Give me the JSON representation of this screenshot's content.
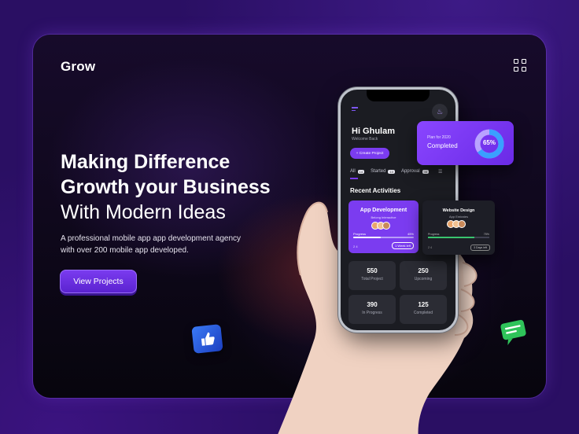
{
  "brand": {
    "logo": "Grow"
  },
  "hero": {
    "title_line1": "Making Difference",
    "title_line2": "Growth your Business",
    "title_line3": "With Modern Ideas",
    "description": "A professional mobile app app development agency with over 200 mobile app developed.",
    "cta_label": "View Projects"
  },
  "phone": {
    "greeting": "Hi Ghulam",
    "welcome": "Welcome Back",
    "create_button": "+ Create Project",
    "tabs": [
      {
        "label": "All",
        "count": "14"
      },
      {
        "label": "Started",
        "count": "10"
      },
      {
        "label": "Approval",
        "count": "08"
      }
    ],
    "recent_title": "Recent Activities",
    "activity": {
      "title": "App Development",
      "subtitle": "Belong Interactive",
      "progress_label": "Progress",
      "progress_value": "45%",
      "progress": 0.45,
      "meta": "2   4",
      "time": "1 Week left"
    },
    "stats": [
      {
        "value": "550",
        "label": "Total Project"
      },
      {
        "value": "250",
        "label": "Upcoming"
      },
      {
        "value": "390",
        "label": "In Progress"
      },
      {
        "value": "125",
        "label": "Completed"
      }
    ]
  },
  "plan_card": {
    "caption": "Plan for 2020",
    "status": "Completed",
    "percent_label": "65%",
    "percent": 0.65
  },
  "web_card": {
    "title": "Website Design",
    "subtitle": "App Emirates",
    "progress_label": "Progress",
    "progress_value": "75%",
    "progress": 0.75,
    "meta": "2   4",
    "time": "3 Days left"
  },
  "colors": {
    "accent": "#7b3cf0",
    "background": "#2a0f63",
    "success": "#39c46e"
  }
}
